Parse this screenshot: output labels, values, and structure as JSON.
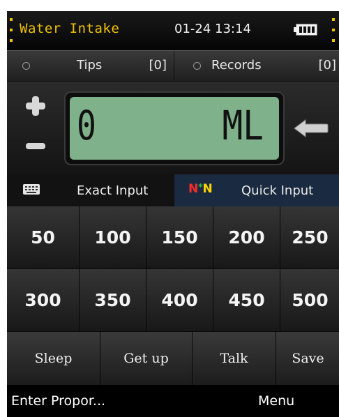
{
  "status_bar": {
    "app_title": "Water Intake",
    "datetime": "01-24 13:14",
    "battery_icon": "battery-icon",
    "accent_color": "#f0c400"
  },
  "tabs": [
    {
      "label": "Tips",
      "count": "[0]"
    },
    {
      "label": "Records",
      "count": "[0]"
    }
  ],
  "display": {
    "value": "0",
    "unit": "ML",
    "lcd_color": "#7fb18a",
    "plus_icon": "plus-icon",
    "minus_icon": "minus-icon",
    "backspace_icon": "backspace-arrow-icon"
  },
  "input_modes": {
    "exact_label": "Exact Input",
    "exact_icon": "keyboard-icon",
    "quick_label": "Quick Input",
    "quick_icon": "n-star-n-icon",
    "quick_active_color": "#1a2a40"
  },
  "keypad": [
    [
      "50",
      "100",
      "150",
      "200",
      "250"
    ],
    [
      "300",
      "350",
      "400",
      "450",
      "500"
    ]
  ],
  "actions": [
    "Sleep",
    "Get up",
    "Talk",
    "Save"
  ],
  "softkeys": {
    "left": "Enter Propor...",
    "right": "Menu"
  }
}
